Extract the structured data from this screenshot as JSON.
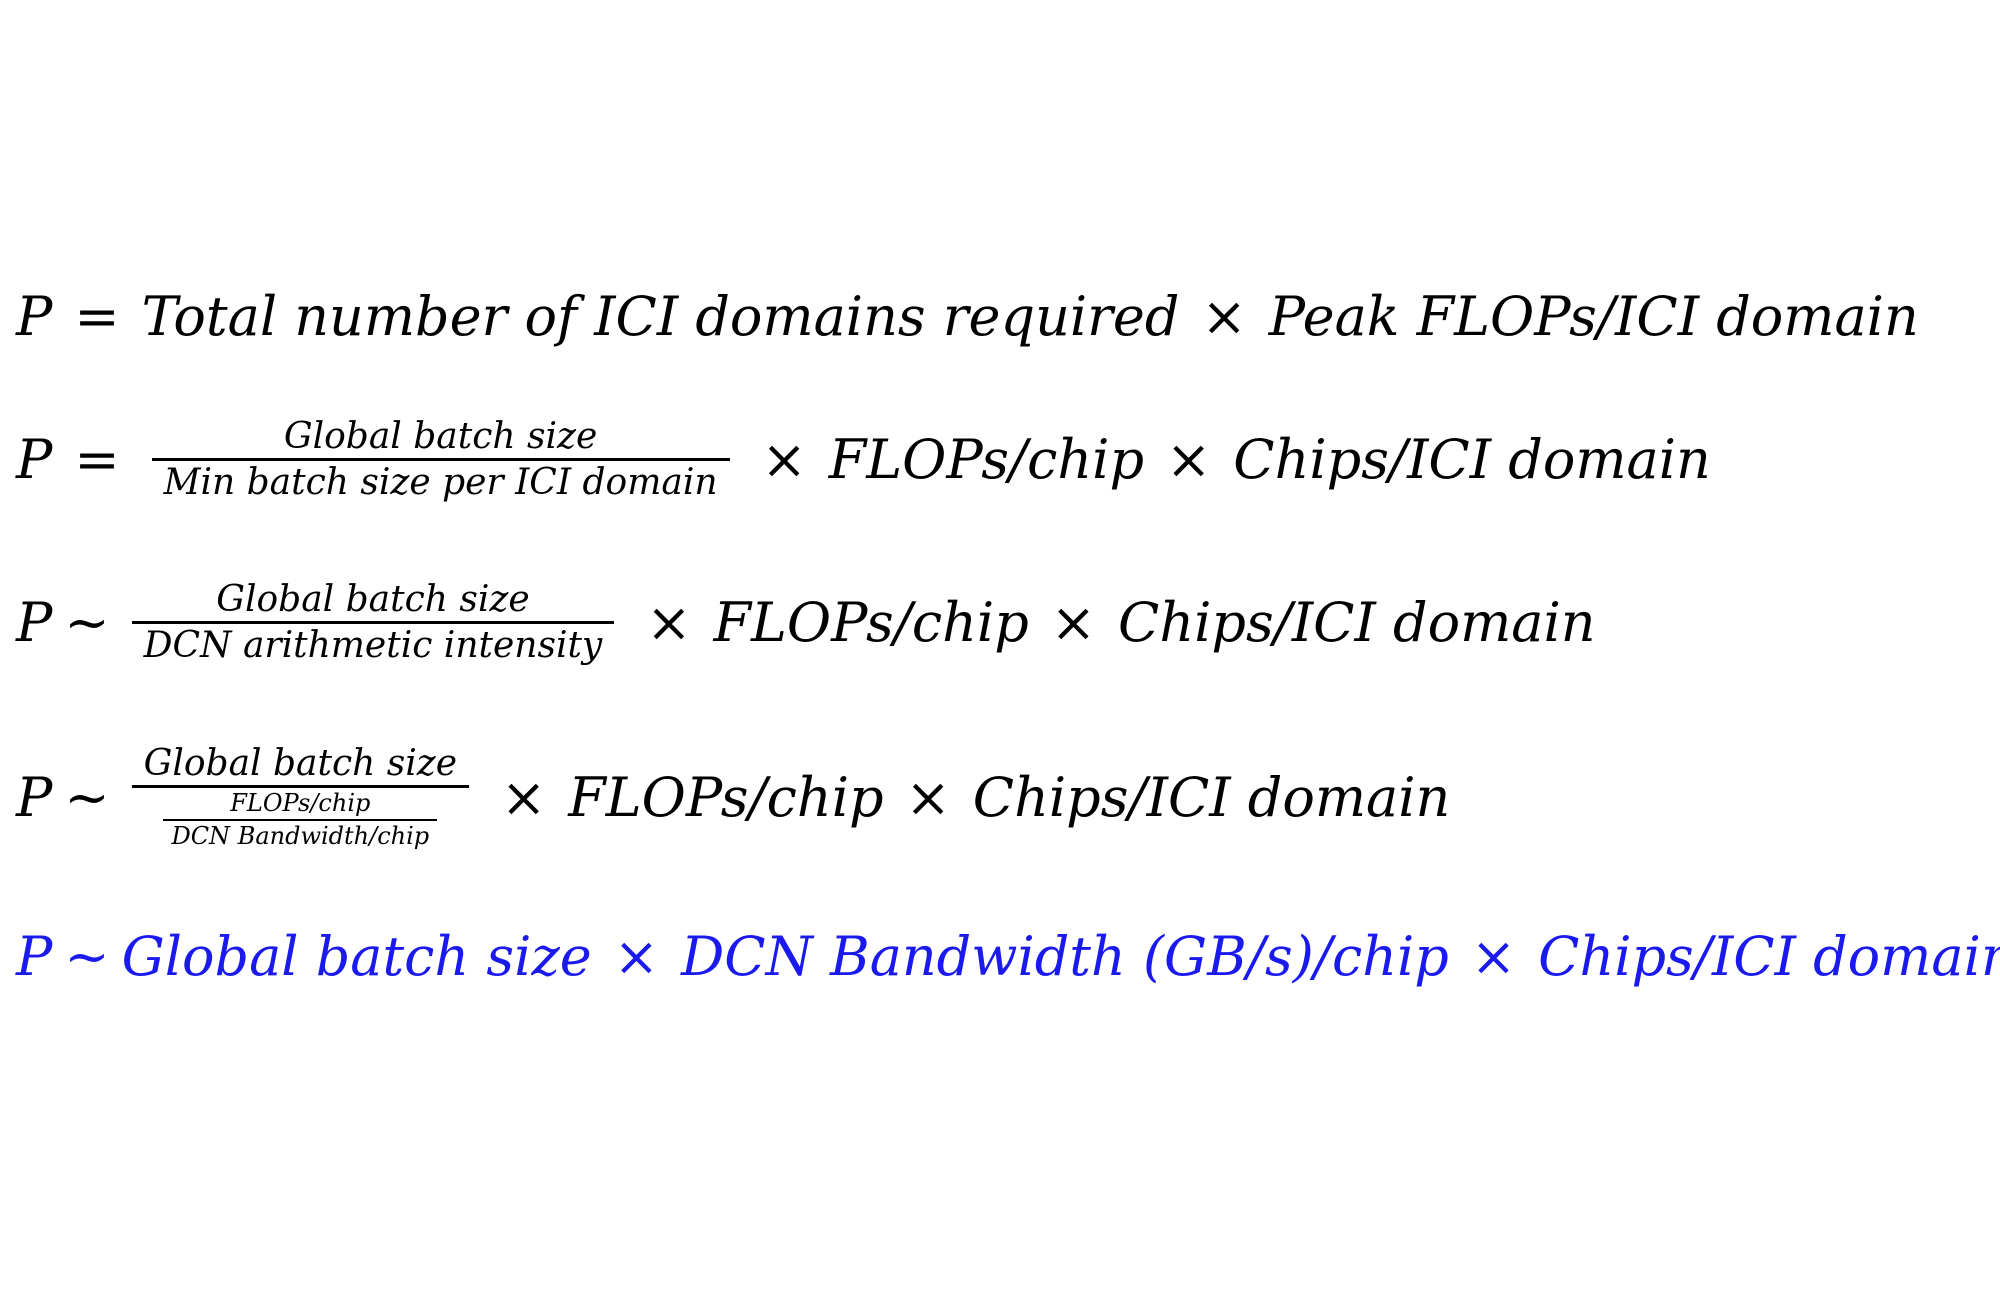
{
  "equations": [
    {
      "lhs": "P",
      "rel": "=",
      "term1": "Total number of ICI domains required",
      "op": "×",
      "term2": "Peak FLOPs/ICI domain"
    },
    {
      "lhs": "P",
      "rel": "=",
      "numerator": "Global batch size",
      "denominator": "Min batch size per ICI domain",
      "op1": "×",
      "term1": "FLOPs/chip",
      "op2": "×",
      "term2": "Chips/ICI domain"
    },
    {
      "lhs": "P",
      "rel": "~",
      "numerator": "Global batch size",
      "denominator": "DCN arithmetic intensity",
      "op1": "×",
      "term1": "FLOPs/chip",
      "op2": "×",
      "term2": "Chips/ICI domain"
    },
    {
      "lhs": "P",
      "rel": "~",
      "numerator": "Global batch size",
      "sub_numerator": "FLOPs/chip",
      "sub_denominator": "DCN Bandwidth/chip",
      "op1": "×",
      "term1": "FLOPs/chip",
      "op2": "×",
      "term2": "Chips/ICI domain"
    },
    {
      "lhs": "P",
      "rel": "~",
      "term1": "Global batch size",
      "op1": "×",
      "term2": "DCN Bandwidth (GB/s)/chip",
      "op2": "×",
      "term3": "Chips/ICI domain",
      "color": "#1a1aee"
    }
  ]
}
